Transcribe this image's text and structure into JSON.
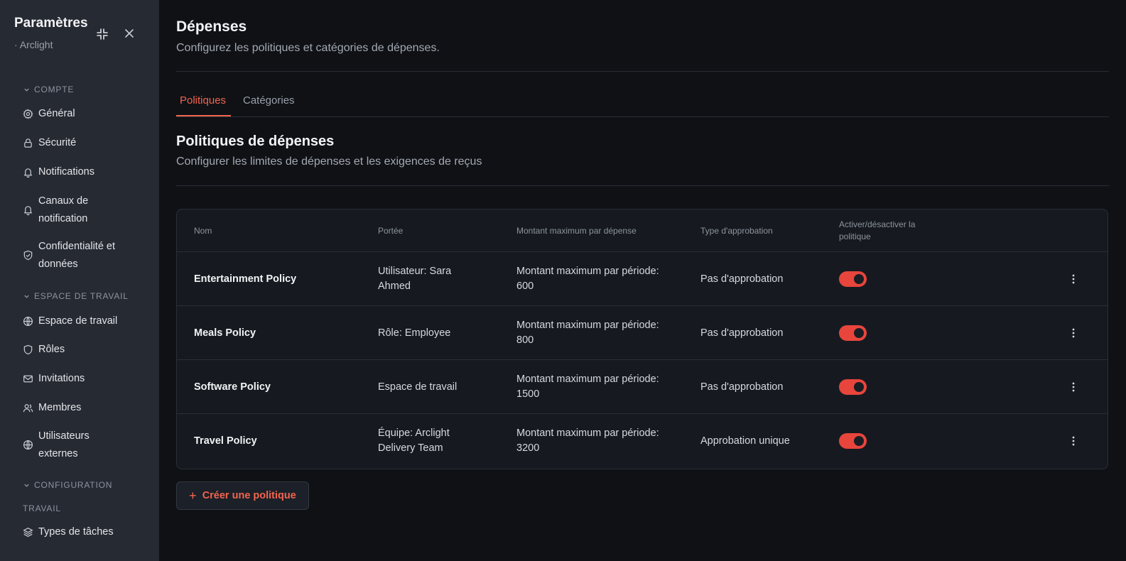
{
  "sidebar": {
    "title": "Paramètres",
    "subtitle": "· Arclight",
    "sections": {
      "compte": "COMPTE",
      "espace": "ESPACE DE TRAVAIL",
      "configuration": "CONFIGURATION",
      "travail": "TRAVAIL"
    },
    "items": {
      "general": "Général",
      "securite": "Sécurité",
      "notifications": "Notifications",
      "canaux_1": "Canaux de",
      "canaux_2": "notification",
      "confidentialite_1": "Confidentialité et",
      "confidentialite_2": "données",
      "espace": "Espace de travail",
      "roles": "Rôles",
      "invitations": "Invitations",
      "membres": "Membres",
      "externes_1": "Utilisateurs",
      "externes_2": "externes",
      "types_taches": "Types de tâches"
    }
  },
  "page": {
    "title": "Dépenses",
    "subtitle": "Configurez les politiques et catégories de dépenses."
  },
  "tabs": {
    "policies": "Politiques",
    "categories": "Catégories"
  },
  "section": {
    "title": "Politiques de dépenses",
    "subtitle": "Configurer les limites de dépenses et les exigences de reçus"
  },
  "table": {
    "headers": {
      "name": "Nom",
      "scope": "Portée",
      "max": "Montant maximum par dépense",
      "approval": "Type d'approbation",
      "toggle_1": "Activer/désactiver la",
      "toggle_2": "politique"
    },
    "rows": [
      {
        "name": "Entertainment Policy",
        "scope_1": "Utilisateur: Sara",
        "scope_2": "Ahmed",
        "max_1": "Montant maximum par période:",
        "max_2": "600",
        "approval": "Pas d'approbation",
        "enabled": true
      },
      {
        "name": "Meals Policy",
        "scope_1": "Rôle: Employee",
        "scope_2": "",
        "max_1": "Montant maximum par période:",
        "max_2": "800",
        "approval": "Pas d'approbation",
        "enabled": true
      },
      {
        "name": "Software Policy",
        "scope_1": "Espace de travail",
        "scope_2": "",
        "max_1": "Montant maximum par période:",
        "max_2": "1500",
        "approval": "Pas d'approbation",
        "enabled": true
      },
      {
        "name": "Travel Policy",
        "scope_1": "Équipe: Arclight",
        "scope_2": "Delivery Team",
        "max_1": "Montant maximum par période:",
        "max_2": "3200",
        "approval": "Approbation unique",
        "enabled": true
      }
    ]
  },
  "actions": {
    "create_policy": "Créer une politique"
  },
  "colors": {
    "accent": "#f2654f",
    "toggle_on": "#e8453c",
    "sidebar_bg": "#262a33",
    "main_bg": "#0f1115"
  }
}
